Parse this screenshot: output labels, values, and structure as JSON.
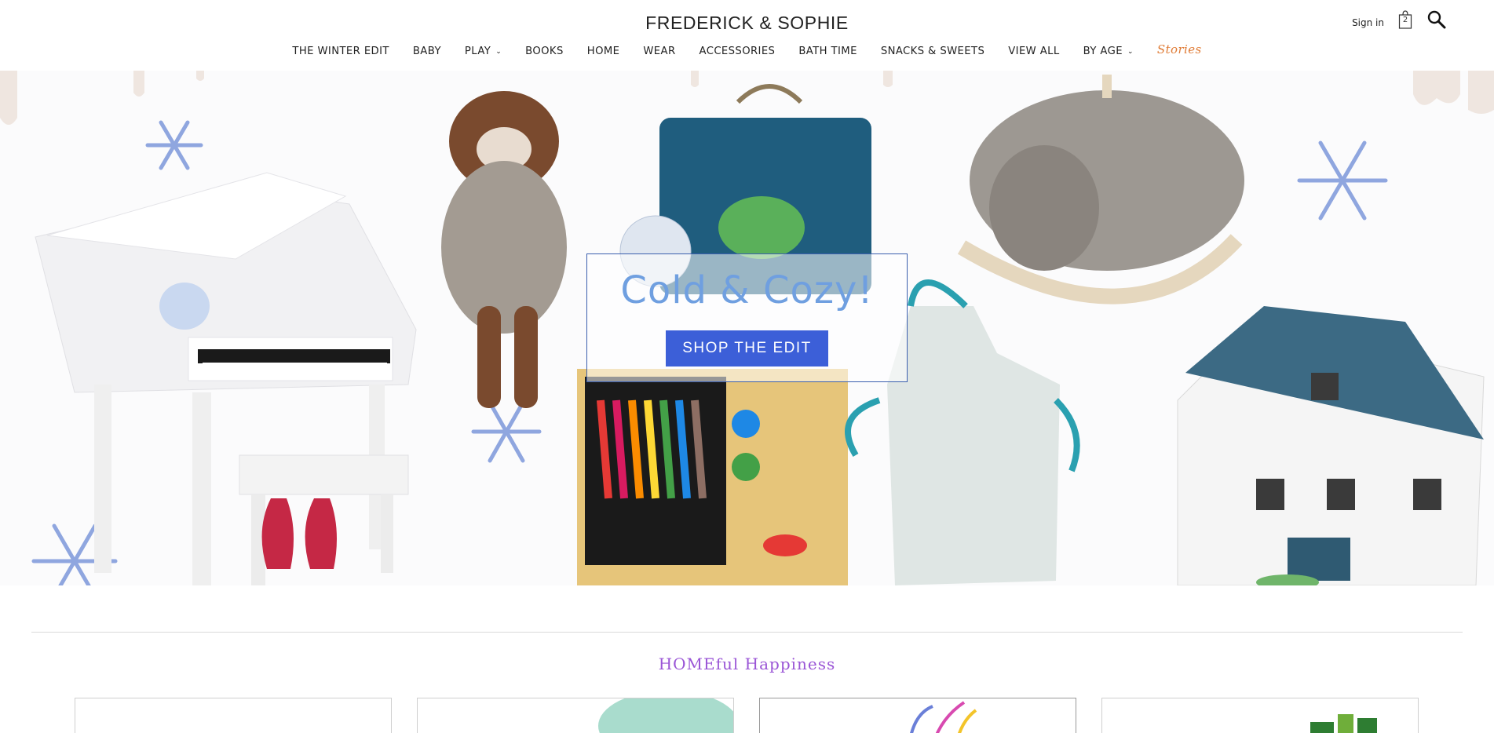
{
  "header": {
    "brand": "FREDERICK & SOPHIE",
    "sign_in": "Sign in",
    "cart_count": "2",
    "icons": {
      "bag": "shopping-bag-icon",
      "search": "search-icon"
    }
  },
  "nav": {
    "items": [
      {
        "label": "THE WINTER EDIT",
        "dropdown": false
      },
      {
        "label": "BABY",
        "dropdown": false
      },
      {
        "label": "PLAY",
        "dropdown": true
      },
      {
        "label": "BOOKS",
        "dropdown": false
      },
      {
        "label": "HOME",
        "dropdown": false
      },
      {
        "label": "WEAR",
        "dropdown": false
      },
      {
        "label": "ACCESSORIES",
        "dropdown": false
      },
      {
        "label": "BATH TIME",
        "dropdown": false
      },
      {
        "label": "SNACKS & SWEETS",
        "dropdown": false
      },
      {
        "label": "VIEW ALL",
        "dropdown": false
      },
      {
        "label": "BY AGE",
        "dropdown": true
      }
    ],
    "stories": "Stories",
    "stories_color": "#e07b35"
  },
  "hero": {
    "title": "Cold & Cozy!",
    "cta": "SHOP THE EDIT",
    "title_color": "#6f9fe0",
    "cta_color": "#3c5fd8"
  },
  "section": {
    "title": "HOMEful Happiness",
    "title_color": "#9a55d6"
  }
}
